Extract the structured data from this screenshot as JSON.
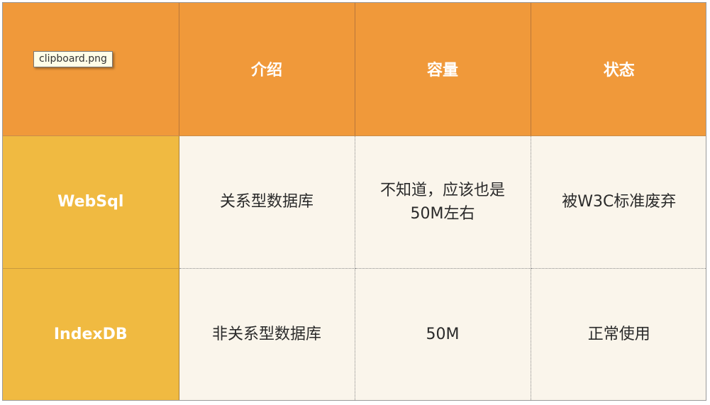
{
  "tooltip": {
    "text": "clipboard.png"
  },
  "table": {
    "header": {
      "corner": "",
      "columns": [
        "介绍",
        "容量",
        "状态"
      ]
    },
    "rows": [
      {
        "name": "WebSql",
        "intro": "关系型数据库",
        "capacity": "不知道，应该也是50M左右",
        "status": "被W3C标准废弃"
      },
      {
        "name": "IndexDB",
        "intro": "非关系型数据库",
        "capacity": "50M",
        "status": "正常使用"
      }
    ]
  },
  "colors": {
    "header_bg": "#f0993a",
    "row_header_bg": "#f0ba41",
    "cell_bg": "#faf5eb",
    "header_text": "#ffffff",
    "cell_text": "#2a2a2a"
  }
}
